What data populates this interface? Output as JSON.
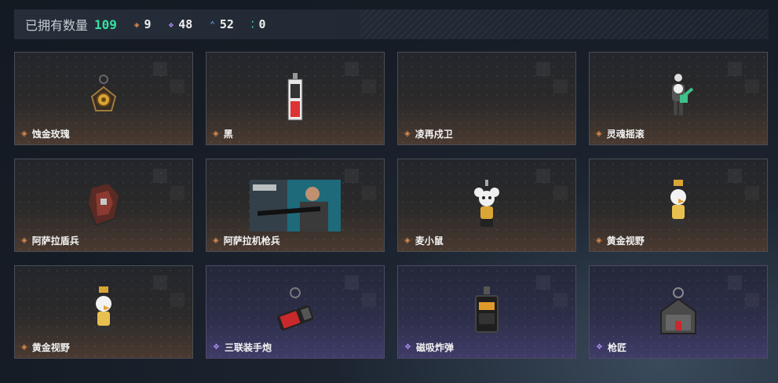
{
  "header": {
    "owned_label": "已拥有数量",
    "owned_count": "109",
    "stats": [
      {
        "icon": "orange-diamond-icon",
        "value": "9",
        "color": "#e08a4a",
        "glyph": "◈"
      },
      {
        "icon": "purple-diamond-icon",
        "value": "48",
        "color": "#a68cf0",
        "glyph": "❖"
      },
      {
        "icon": "blue-chevron-icon",
        "value": "52",
        "color": "#5fa8ff",
        "glyph": "⌃"
      },
      {
        "icon": "green-dots-icon",
        "value": "0",
        "color": "#35e0a0",
        "glyph": "⁚"
      }
    ]
  },
  "items": [
    {
      "name": "蚀金玫瑰",
      "rarity": "orange"
    },
    {
      "name": "黑",
      "rarity": "orange"
    },
    {
      "name": "凌再戍卫",
      "rarity": "orange"
    },
    {
      "name": "灵魂摇滚",
      "rarity": "orange"
    },
    {
      "name": "阿萨拉盾兵",
      "rarity": "orange"
    },
    {
      "name": "阿萨拉机枪兵",
      "rarity": "orange"
    },
    {
      "name": "麦小鼠",
      "rarity": "orange"
    },
    {
      "name": "黄金视野",
      "rarity": "orange"
    },
    {
      "name": "黄金视野",
      "rarity": "orange"
    },
    {
      "name": "三联装手炮",
      "rarity": "purple"
    },
    {
      "name": "磁吸炸弹",
      "rarity": "purple"
    },
    {
      "name": "枪匠",
      "rarity": "purple"
    }
  ],
  "glyphs": {
    "orange": "◈",
    "purple": "❖"
  }
}
